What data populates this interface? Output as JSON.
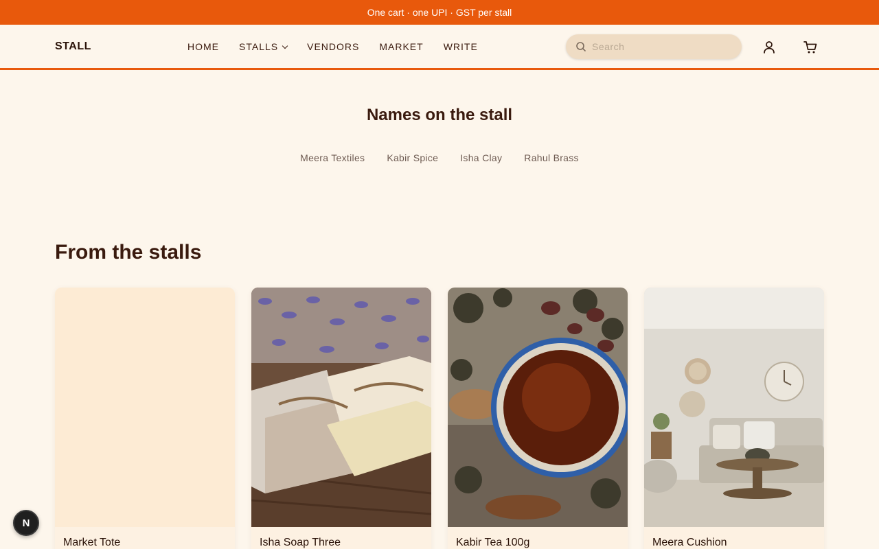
{
  "promo": {
    "text": "One cart · one UPI · GST per stall"
  },
  "header": {
    "logo": "STALL",
    "nav": [
      "HOME",
      "STALLS",
      "VENDORS",
      "MARKET",
      "WRITE"
    ],
    "search_placeholder": "Search",
    "icons": [
      "search-icon",
      "user-icon",
      "cart-icon",
      "chevron-down-icon"
    ]
  },
  "names": {
    "title": "Names on the stall",
    "items": [
      "Meera Textiles",
      "Kabir Spice",
      "Isha Clay",
      "Rahul Brass"
    ]
  },
  "stalls": {
    "title": "From the stalls",
    "products": [
      {
        "name": "Market Tote"
      },
      {
        "name": "Isha Soap Three"
      },
      {
        "name": "Kabir Tea 100g"
      },
      {
        "name": "Meera Cushion"
      }
    ]
  },
  "badge": {
    "label": "N"
  },
  "colors": {
    "accent": "#e8590c",
    "background": "#fdf6ec",
    "text": "#3a1a0e"
  }
}
